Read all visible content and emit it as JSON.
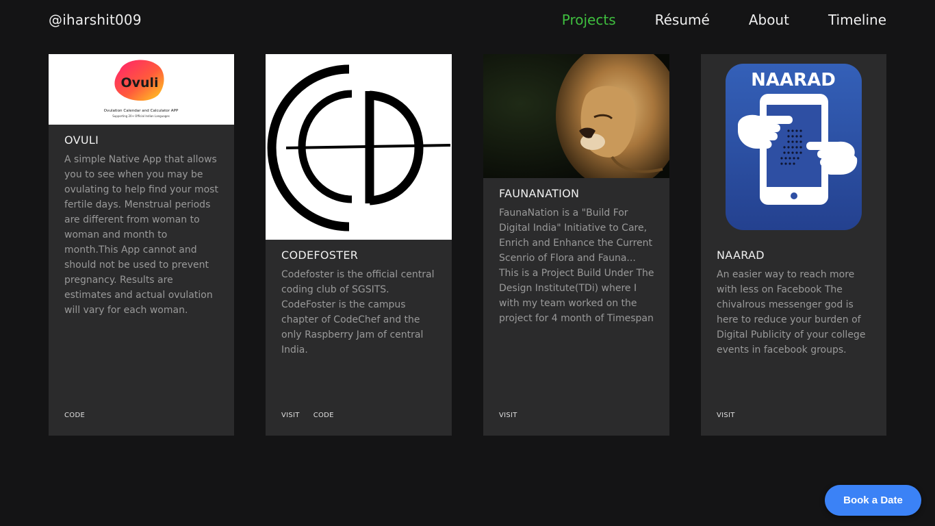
{
  "header": {
    "brand": "@iharshit009",
    "nav": [
      {
        "label": "Projects",
        "active": true
      },
      {
        "label": "Résumé",
        "active": false
      },
      {
        "label": "About",
        "active": false
      },
      {
        "label": "Timeline",
        "active": false
      }
    ]
  },
  "projects": [
    {
      "title": "OVULI",
      "image_logo_text": "Ovuli",
      "image_caption": "Ovulation Calendar and Calculator APP",
      "image_subcaption": "Supporting 20+ Official Indian Languages",
      "description": "A simple Native App that allows you to see when you may be ovulating to help find your most fertile days. Menstrual periods are different from woman to woman and month to month.This App cannot and should not be used to prevent pregnancy. Results are estimates and actual ovulation will vary for each woman.",
      "links": [
        "CODE"
      ]
    },
    {
      "title": "CODEFOSTER",
      "image_icon": "codefoster-logo-icon",
      "description": "Codefoster is the official central coding club of SGSITS. CodeFoster is the campus chapter of CodeChef and the only Raspberry Jam of central India.",
      "links": [
        "VISIT",
        "CODE"
      ]
    },
    {
      "title": "FAUNANATION",
      "image_icon": "lion-photo",
      "description": "FaunaNation is a \"Build For Digital India\" Initiative to Care, Enrich and Enhance the Current Scenrio of Flora and Fauna... This is a Project Build Under The Design Institute(TDi) where I with my team worked on the project for 4 month of Timespan",
      "links": [
        "VISIT"
      ]
    },
    {
      "title": "NAARAD",
      "image_logo_text": "NAARAD",
      "image_icon": "phone-hands-icon",
      "description": "An easier way to reach more with less on Facebook The chivalrous messenger god is here to reduce your burden of Digital Publicity of your college events in facebook groups.",
      "links": [
        "VISIT"
      ]
    }
  ],
  "book_button": "Book a Date",
  "colors": {
    "background": "#141415",
    "card": "#2b2b2c",
    "nav_active": "#3fbf3f",
    "button": "#3b82f6",
    "naarad_blue": "#2e4fa3"
  }
}
